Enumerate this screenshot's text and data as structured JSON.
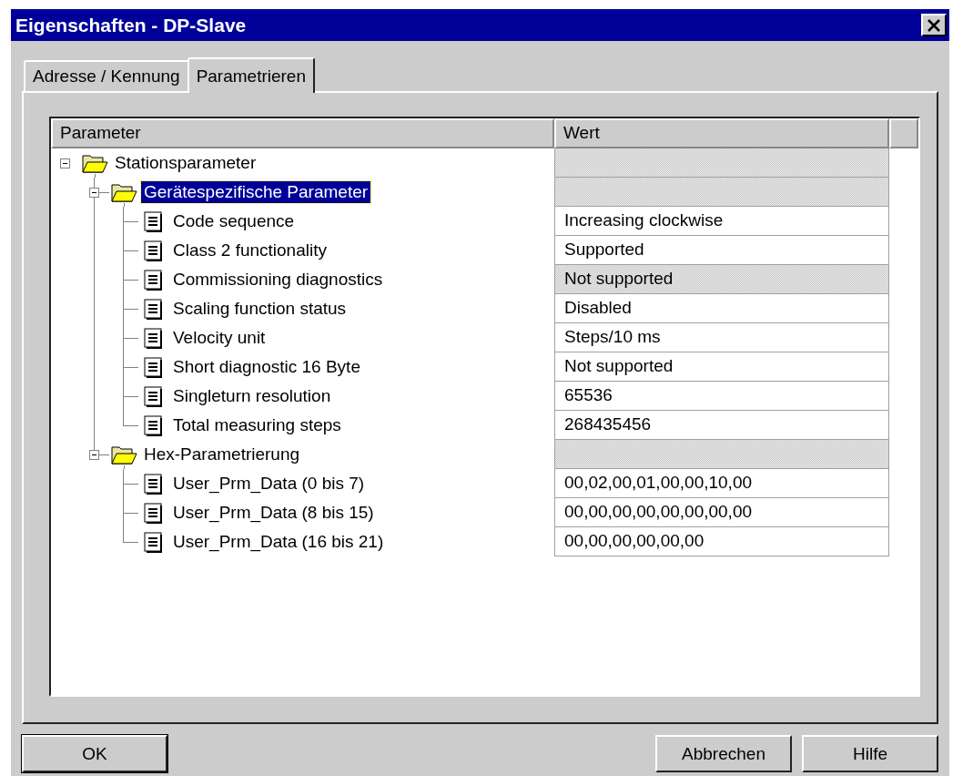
{
  "window": {
    "title": "Eigenschaften - DP-Slave"
  },
  "tabs": [
    {
      "label": "Adresse / Kennung",
      "selected": false
    },
    {
      "label": "Parametrieren",
      "selected": true
    }
  ],
  "table": {
    "columns": [
      "Parameter",
      "Wert"
    ],
    "tree": [
      {
        "kind": "folder",
        "label": "Stationsparameter",
        "expanded": true,
        "selected": false,
        "readonly": true,
        "children": [
          {
            "kind": "folder",
            "label": "Gerätespezifische Parameter",
            "expanded": true,
            "selected": true,
            "readonly": true,
            "children": [
              {
                "kind": "item",
                "label": "Code sequence",
                "value": "Increasing clockwise",
                "readonly": false,
                "selected": false
              },
              {
                "kind": "item",
                "label": "Class 2 functionality",
                "value": "Supported",
                "readonly": false,
                "selected": false
              },
              {
                "kind": "item",
                "label": "Commissioning diagnostics",
                "value": "Not supported",
                "readonly": true,
                "selected": false
              },
              {
                "kind": "item",
                "label": "Scaling function status",
                "value": "Disabled",
                "readonly": false,
                "selected": false
              },
              {
                "kind": "item",
                "label": "Velocity unit",
                "value": "Steps/10 ms",
                "readonly": false,
                "selected": false
              },
              {
                "kind": "item",
                "label": "Short diagnostic 16 Byte",
                "value": "Not supported",
                "readonly": false,
                "selected": false
              },
              {
                "kind": "item",
                "label": "Singleturn resolution",
                "value": "65536",
                "readonly": false,
                "selected": false
              },
              {
                "kind": "item",
                "label": "Total measuring steps",
                "value": "268435456",
                "readonly": false,
                "selected": false
              }
            ]
          },
          {
            "kind": "folder",
            "label": "Hex-Parametrierung",
            "expanded": true,
            "selected": false,
            "readonly": true,
            "children": [
              {
                "kind": "item",
                "label": "User_Prm_Data (0 bis 7)",
                "value": "00,02,00,01,00,00,10,00",
                "readonly": false,
                "selected": false
              },
              {
                "kind": "item",
                "label": "User_Prm_Data (8 bis 15)",
                "value": "00,00,00,00,00,00,00,00",
                "readonly": false,
                "selected": false
              },
              {
                "kind": "item",
                "label": "User_Prm_Data (16 bis 21)",
                "value": "00,00,00,00,00,00",
                "readonly": false,
                "selected": false
              }
            ]
          }
        ]
      }
    ]
  },
  "buttons": [
    {
      "label": "OK",
      "default": true
    },
    {
      "label": "Abbrechen",
      "default": false
    },
    {
      "label": "Hilfe",
      "default": false
    }
  ]
}
